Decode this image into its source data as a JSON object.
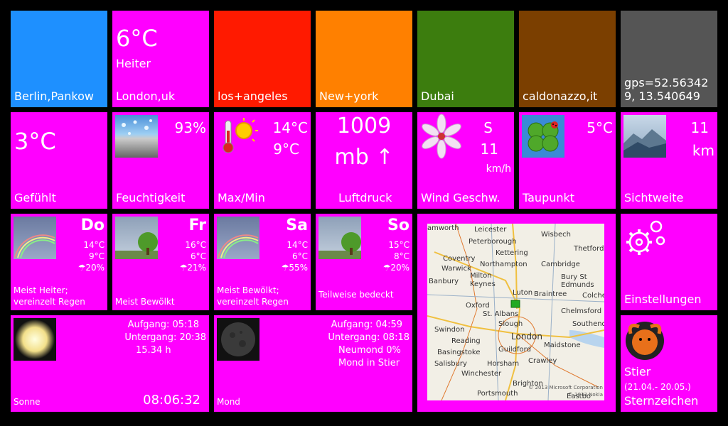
{
  "cities": [
    {
      "name": "Berlin,Pankow",
      "color": "#1e90ff"
    },
    {
      "name": "London,uk",
      "color": "#ff00ff",
      "temp": "6°C",
      "cond": "Heiter"
    },
    {
      "name": "los+angeles",
      "color": "#ff1a00"
    },
    {
      "name": "New+york",
      "color": "#ff8000"
    },
    {
      "name": "Dubai",
      "color": "#3c7d0e"
    },
    {
      "name": "caldonazzo,it",
      "color": "#7b3f00"
    },
    {
      "name": "gps=52.563429, 13.540649",
      "color": "#555555"
    }
  ],
  "stats": {
    "felt": {
      "value": "3°C",
      "label": "Gefühlt"
    },
    "humidity": {
      "value": "93%",
      "label": "Feuchtigkeit"
    },
    "maxmin": {
      "max": "14°C",
      "min": "9°C",
      "label": "Max/Min"
    },
    "pressure": {
      "value": "1009",
      "unit": "mb ↑",
      "label": "Luftdruck"
    },
    "wind": {
      "dir": "S",
      "speed": "11",
      "unit": "km/h",
      "label": "Wind Geschw."
    },
    "dewpoint": {
      "value": "5°C",
      "label": "Taupunkt"
    },
    "visibility": {
      "value": "11",
      "unit": "km",
      "label": "Sichtweite"
    }
  },
  "forecast": [
    {
      "day": "Do",
      "max": "14°C",
      "min": "9°C",
      "rain": "☂20%",
      "text": "Meist Heiter; vereinzelt Regen"
    },
    {
      "day": "Fr",
      "max": "16°C",
      "min": "6°C",
      "rain": "☂21%",
      "text": "Meist Bewölkt"
    },
    {
      "day": "Sa",
      "max": "14°C",
      "min": "6°C",
      "rain": "☂55%",
      "text": "Meist Bewölkt; vereinzelt Regen"
    },
    {
      "day": "So",
      "max": "15°C",
      "min": "8°C",
      "rain": "☂20%",
      "text": "Teilweise bedeckt"
    }
  ],
  "sun": {
    "rise": "Aufgang: 05:18",
    "set": "Untergang: 20:38",
    "duration": "15.34 h",
    "time": "08:06:32",
    "label": "Sonne"
  },
  "moon": {
    "rise": "Aufgang: 04:59",
    "set": "Untergang: 08:18",
    "phase": "Neumond 0%",
    "sign": "Mond in Stier",
    "label": "Mond"
  },
  "settings": {
    "label": "Einstellungen"
  },
  "zodiac": {
    "sign": "Stier",
    "dates": "(21.04.- 20.05.)",
    "label": "Sternzeichen"
  },
  "map": {
    "places": [
      {
        "n": "amworth"
      },
      {
        "n": "Leicester"
      },
      {
        "n": "Wisbech"
      },
      {
        "n": "Peterborough"
      },
      {
        "n": "Kettering"
      },
      {
        "n": "Thetford"
      },
      {
        "n": "Coventry"
      },
      {
        "n": "Northampton"
      },
      {
        "n": "Cambridge"
      },
      {
        "n": "Warwick"
      },
      {
        "n": "Milton"
      },
      {
        "n": "Keynes"
      },
      {
        "n": "Bury St Edmunds"
      },
      {
        "n": "Banbury"
      },
      {
        "n": "Luton"
      },
      {
        "n": "Braintree"
      },
      {
        "n": "Colches"
      },
      {
        "n": "Oxford"
      },
      {
        "n": "St. Albans"
      },
      {
        "n": "Chelmsford"
      },
      {
        "n": "Slough"
      },
      {
        "n": "Southend-"
      },
      {
        "n": "London"
      },
      {
        "n": "Swindon"
      },
      {
        "n": "Reading"
      },
      {
        "n": "Basingstoke"
      },
      {
        "n": "Guildford"
      },
      {
        "n": "Maidstone"
      },
      {
        "n": "Salisbury"
      },
      {
        "n": "Horsham"
      },
      {
        "n": "Winchester"
      },
      {
        "n": "Crawley"
      },
      {
        "n": "Brighton"
      },
      {
        "n": "Portsmouth"
      },
      {
        "n": "Eastbo"
      }
    ],
    "credit1": "© 2013 Microsoft Corporation",
    "credit2": "© 2013 Nokia"
  }
}
